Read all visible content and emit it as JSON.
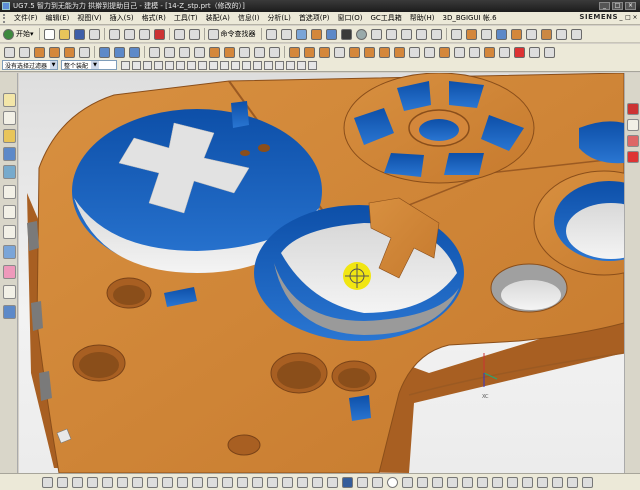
{
  "window": {
    "title": "UG7.5 智力到无能为力 拱擀到提助目己 - 建模 - [14-Z_stp.prt（修改的）]",
    "controls": [
      "_",
      "□",
      "×"
    ]
  },
  "menubar": {
    "items": [
      "文件(F)",
      "编辑(E)",
      "视图(V)",
      "插入(S)",
      "格式(R)",
      "工具(T)",
      "装配(A)",
      "信息(I)",
      "分析(L)",
      "首选项(P)",
      "窗口(O)",
      "GC工具箱",
      "帮助(H)"
    ],
    "extra": "3D_BGIGUI 帐.6",
    "brand": "SIEMENS",
    "doc_controls": [
      "_",
      "□",
      "×"
    ]
  },
  "toolbar1": {
    "start_label": "开始▾",
    "find_command_label": "命令查找器"
  },
  "selectionbar": {
    "filter_value": "没有选择过滤器",
    "scope_value": "整个装配"
  },
  "icons": {
    "colors": {
      "part_orange": "#d4873b",
      "part_orange_dark": "#a85f22",
      "cut_blue": "#1a5fb4",
      "highlight_yellow": "#f1e612",
      "wall_gray": "#9a9a9a"
    }
  },
  "viewport": {
    "axis_label": "XC"
  }
}
